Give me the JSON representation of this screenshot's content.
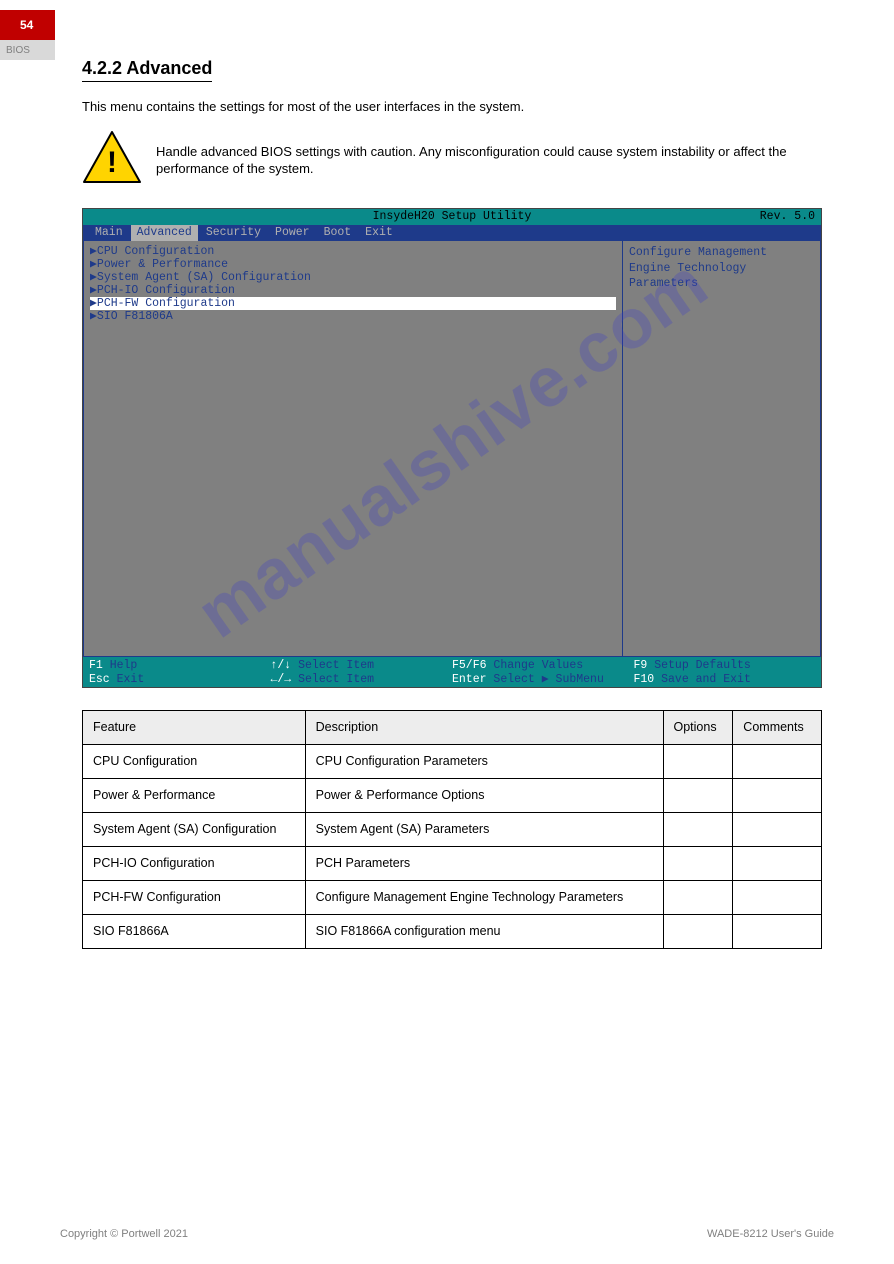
{
  "header": {
    "page_number": "54",
    "tab_text": "BIOS"
  },
  "section": {
    "heading": "4.2.2 Advanced",
    "intro": "This menu contains the settings for most of the user interfaces in the system.",
    "warning": "Handle advanced BIOS settings with caution. Any misconfiguration could cause system instability or affect the performance of the system."
  },
  "bios": {
    "title": "InsydeH20 Setup Utility",
    "rev": "Rev. 5.0",
    "tabs": [
      "Main",
      "Advanced",
      "Security",
      "Power",
      "Boot",
      "Exit"
    ],
    "active_tab": 1,
    "left_items": [
      "▶CPU Configuration",
      "▶Power & Performance",
      "▶System Agent (SA) Configuration",
      "▶PCH-IO Configuration",
      "▶PCH-FW Configuration",
      "▶SIO F81806A"
    ],
    "selected_index": 4,
    "right_text": "Configure Management Engine Technology Parameters",
    "footer": {
      "r1c1_k": "F1",
      "r1c1_v": "Help",
      "r1c2_k": "↑/↓",
      "r1c2_v": "Select Item",
      "r1c3_k": "F5/F6",
      "r1c3_v": "Change Values",
      "r1c4_k": "F9",
      "r1c4_v": "Setup Defaults",
      "r2c1_k": "Esc",
      "r2c1_v": "Exit",
      "r2c2_k": "←/→",
      "r2c2_v": "Select Item",
      "r2c3_k": "Enter",
      "r2c3_v": "Select ▶ SubMenu",
      "r2c4_k": "F10",
      "r2c4_v": "Save and Exit"
    }
  },
  "table": {
    "headers": [
      "Feature",
      "Description",
      "Options",
      "Comments"
    ],
    "rows": [
      [
        "CPU Configuration",
        "CPU Configuration Parameters",
        "",
        ""
      ],
      [
        "Power & Performance",
        "Power & Performance Options",
        "",
        ""
      ],
      [
        "System Agent (SA) Configuration",
        "System Agent (SA) Parameters",
        "",
        ""
      ],
      [
        "PCH-IO Configuration",
        "PCH Parameters",
        "",
        ""
      ],
      [
        "PCH-FW Configuration",
        "Configure Management Engine Technology Parameters",
        "",
        ""
      ],
      [
        "SIO F81866A",
        "SIO F81866A configuration menu",
        "",
        ""
      ]
    ]
  },
  "footer_bar": {
    "left": "Copyright © Portwell 2021",
    "right": "WADE-8212 User's Guide"
  },
  "watermark": "manualshive.com"
}
